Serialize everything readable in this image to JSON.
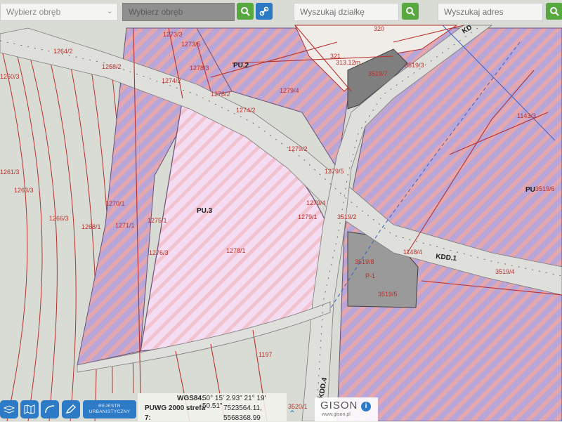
{
  "toolbar": {
    "select_obreb_1": "Wybierz obręb",
    "select_obreb_2": "Wybierz obręb",
    "search_parcel_placeholder": "Wyszukaj działkę",
    "search_address_placeholder": "Wyszukaj adres"
  },
  "map": {
    "zones": [
      "PU.2",
      "PU.3",
      "PU",
      "KDD.1",
      "KDD.4",
      "KD"
    ],
    "parcels": [
      "1273/3",
      "1273/5",
      "1264/2",
      "1268/2",
      "1278/3",
      "1274/2",
      "1279/4",
      "1278/2",
      "1274/2",
      "1279/2",
      "1279/5",
      "1279/1",
      "1279/4",
      "3519/2",
      "3519/3",
      "3519/4",
      "3519/5",
      "3519/6",
      "3519/7",
      "3519/8",
      "1143/3",
      "1148/4",
      "1270/1",
      "1271/1",
      "1275/1",
      "1276/3",
      "1278/1",
      "1266/3",
      "1268/1",
      "1263/3",
      "1261/3",
      "1260/3",
      "1197",
      "320",
      "321",
      "3520/1",
      "P-1"
    ],
    "dimension": "313.12m"
  },
  "bottom": {
    "register_label": "REJESTR URBANISTYCZNY",
    "wgs_label": "WGS84:",
    "wgs_value": "50° 15' 2.93\" 21° 19' 50.51\"",
    "puwg_label": "PUWG 2000 strefa",
    "puwg_x": "7523564.11,",
    "puwg_y": "5568368.99",
    "z_label": "7:"
  },
  "brand": {
    "name": "GISON",
    "url": "www.gison.pl",
    "info": "i"
  },
  "colors": {
    "green": "#58a840",
    "blue": "#2c7ac4",
    "parcel_line": "#b8312d",
    "zone_purple": "#b49fd6"
  }
}
